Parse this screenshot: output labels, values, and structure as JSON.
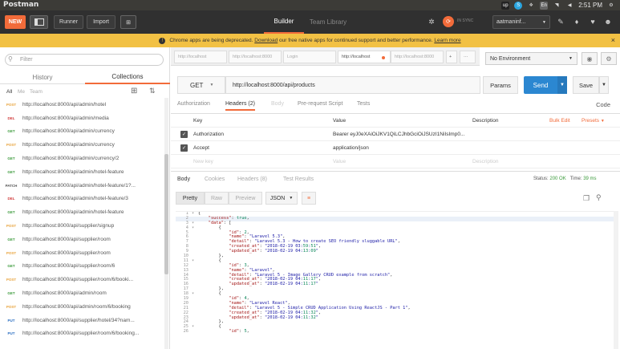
{
  "os": {
    "app_title": "Postman",
    "time": "2:51 PM",
    "tray_icons": [
      "upwork-icon",
      "skype-icon",
      "dropbox-icon",
      "keyboard-icon",
      "wifi-icon",
      "volume-icon",
      "power-icon"
    ],
    "keyboard_label": "En"
  },
  "header": {
    "new_label": "NEW",
    "runner_label": "Runner",
    "import_label": "Import",
    "tab_builder": "Builder",
    "tab_team_library": "Team Library",
    "sync_label": "IN SYNC",
    "workspace": "aatmaninf...",
    "brand_color": "#f26b3a"
  },
  "banner": {
    "text_before": "Chrome apps are being deprecated.",
    "link1": "Download",
    "text_middle": "our free native apps for continued support and better performance.",
    "link2": "Learn more",
    "close": "×"
  },
  "sidebar": {
    "filter_placeholder": "Filter",
    "tab_history": "History",
    "tab_collections": "Collections",
    "sub_all": "All",
    "sub_me": "Me",
    "sub_team": "Team",
    "requests": [
      {
        "method": "POST",
        "url": "http://localhost:8000/api/admin/hotel"
      },
      {
        "method": "DEL",
        "url": "http://localhost:8000/api/admin/media"
      },
      {
        "method": "GET",
        "url": "http://localhost:8000/api/admin/currency"
      },
      {
        "method": "POST",
        "url": "http://localhost:8000/api/admin/currency"
      },
      {
        "method": "GET",
        "url": "http://localhost:8000/api/admin/currency/2"
      },
      {
        "method": "GET",
        "url": "http://localhost:8000/api/admin/hotel-feature"
      },
      {
        "method": "PATCH",
        "url": "http://localhost:8000/api/admin/hotel-feature/1?..."
      },
      {
        "method": "DEL",
        "url": "http://localhost:8000/api/admin/hotel-feature/3"
      },
      {
        "method": "GET",
        "url": "http://localhost:8000/api/admin/hotel-feature"
      },
      {
        "method": "POST",
        "url": "http://localhost:8000/api/supplier/signup"
      },
      {
        "method": "GET",
        "url": "http://localhost:8000/api/supplier/room"
      },
      {
        "method": "POST",
        "url": "http://localhost:8000/api/supplier/room"
      },
      {
        "method": "GET",
        "url": "http://localhost:8000/api/supplier/room/6"
      },
      {
        "method": "POST",
        "url": "http://localhost:8000/api/supplier/room/6/booki..."
      },
      {
        "method": "GET",
        "url": "http://localhost:8000/api/admin/room"
      },
      {
        "method": "POST",
        "url": "http://localhost:8000/api/admin/room/6/booking"
      },
      {
        "method": "PUT",
        "url": "http://localhost:8000/api/supplier/hotel/34?nam..."
      },
      {
        "method": "PUT",
        "url": "http://localhost:8000/api/supplier/room/6/booking..."
      }
    ]
  },
  "tabs": {
    "items": [
      {
        "label": "http://localhost",
        "dot": false
      },
      {
        "label": "http://localhost:8000",
        "dot": false
      },
      {
        "label": "Login",
        "dot": false
      },
      {
        "label": "http://localhost",
        "dot": true
      },
      {
        "label": "http://localhost:8000",
        "dot": false
      }
    ],
    "add": "+",
    "more": "···"
  },
  "env": {
    "selected": "No Environment"
  },
  "request": {
    "method": "GET",
    "url": "http://localhost:8000/api/products",
    "params_label": "Params",
    "send_label": "Send",
    "save_label": "Save",
    "tab_authorization": "Authorization",
    "tab_headers": "Headers (2)",
    "tab_body": "Body",
    "tab_prerequest": "Pre-request Script",
    "tab_tests": "Tests",
    "code_link": "Code"
  },
  "headers_table": {
    "col_key": "Key",
    "col_value": "Value",
    "col_description": "Description",
    "bulk_edit": "Bulk Edit",
    "presets": "Presets",
    "rows": [
      {
        "key": "Authorization",
        "value": "Bearer eyJ0eXAiOiJKV1QiLCJhbGciOiJSUzI1NiIsImp0...",
        "checked": true
      },
      {
        "key": "Accept",
        "value": "application/json",
        "checked": true
      }
    ],
    "placeholder_key": "New key",
    "placeholder_value": "Value",
    "placeholder_description": "Description"
  },
  "response": {
    "tab_body": "Body",
    "tab_cookies": "Cookies",
    "tab_headers": "Headers (8)",
    "tab_tests": "Test Results",
    "status_label": "Status:",
    "status_value": "200 OK",
    "time_label": "Time:",
    "time_value": "39 ms",
    "pretty": "Pretty",
    "raw": "Raw",
    "preview": "Preview",
    "format": "JSON",
    "lines": [
      "{",
      "    \"success\": true,",
      "    \"data\": [",
      "        {",
      "            \"id\": 2,",
      "            \"name\": \"Laravel 5.3\",",
      "            \"detail\": \"Laravel 5.3 - How to create SEO friendly sluggable URL\",",
      "            \"created_at\": \"2018-02-19 03:59:51\",",
      "            \"updated_at\": \"2018-02-19 04:13:09\"",
      "        },",
      "        {",
      "            \"id\": 3,",
      "            \"name\": \"Laravel\",",
      "            \"detail\": \"Laravel 5 - Image Gallery CRUD example from scratch\",",
      "            \"created_at\": \"2018-02-19 04:11:17\",",
      "            \"updated_at\": \"2018-02-19 04:11:17\"",
      "        },",
      "        {",
      "            \"id\": 4,",
      "            \"name\": \"Laravel React\",",
      "            \"detail\": \"Laravel 5 - Simple CRUD Application Using ReactJS - Part 1\",",
      "            \"created_at\": \"2018-02-19 04:11:32\",",
      "            \"updated_at\": \"2018-02-19 04:11:32\"",
      "        },",
      "        {",
      "            \"id\": 5,"
    ]
  }
}
